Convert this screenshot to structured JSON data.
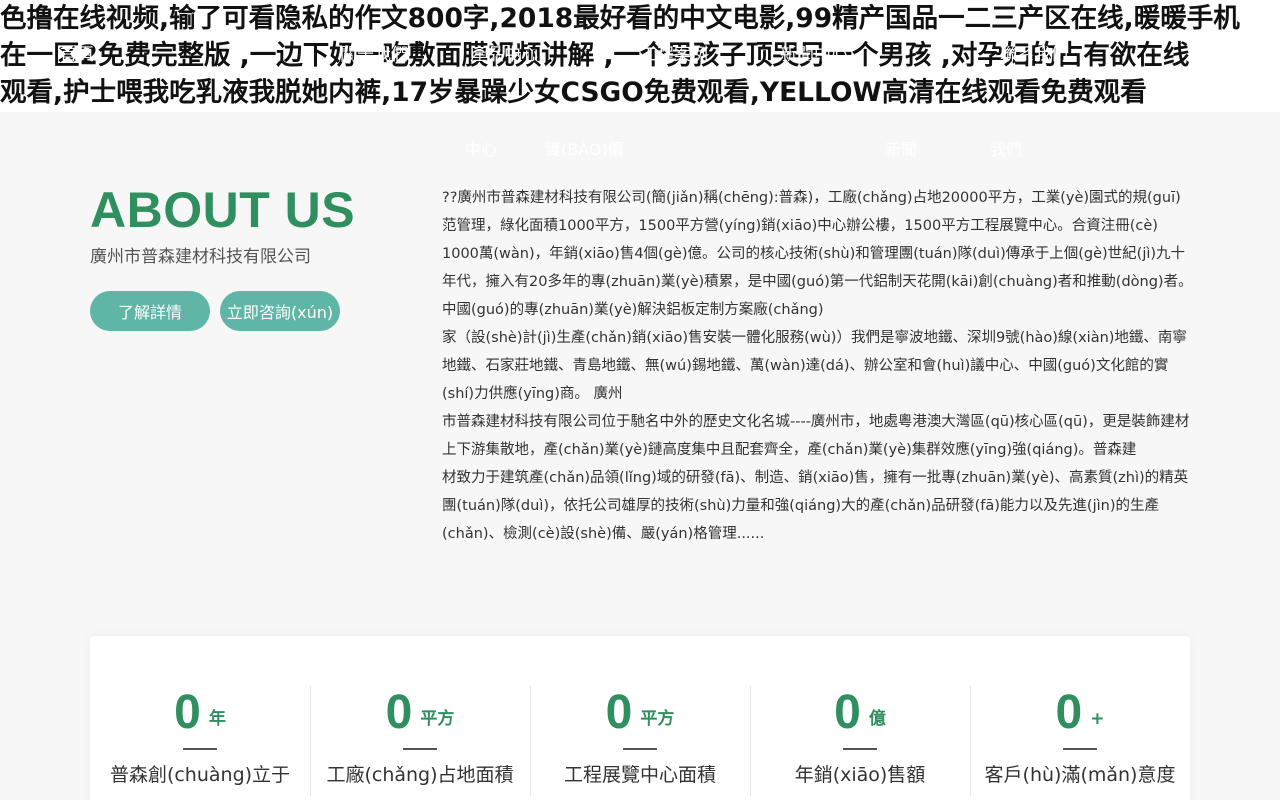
{
  "spam_heading": {
    "line1": "色撸在线视频,输了可看隐私的作文800字,2018最好看的中文电影,99精产国品一二三产区在线,暖暖手机",
    "line2": "在一区2免费完整版 ,一边下奶一吃敷面膜视频讲解 ,一个男孩子顶哭另一个男孩 ,对孕妇的占有欲在线",
    "line3": "观看,护士喂我吃乳液我脱她内裤,17岁暴躁少女CSGO免费观看,YELLOW高清在线观看免费观看"
  },
  "ghost_nav": {
    "item1": "首頁",
    "item2": "關于我們",
    "item3": "產品中心",
    "item4": "工程案例",
    "item5": "新聞中心",
    "item6": "聯系我們"
  },
  "subnav": {
    "item1": "中心",
    "item2": "資(BÀO)價",
    "item3": "新聞",
    "item4": "我們"
  },
  "about": {
    "title": "ABOUT US",
    "company": "廣州市普森建材科技有限公司",
    "btn_detail": "了解詳情",
    "btn_consult": "立即咨詢(xún)",
    "paragraphs": [
      "??廣州市普森建材科技有限公司(簡(jiǎn)稱(chēng):普森)，工廠(chǎng)占地20000平方，工業(yè)園式的規(guī)范管理，綠化面積1000平方，1500平方營(yíng)銷(xiāo)中心辦公樓，1500平方工程展覽中心。合資注冊(cè)",
      "1000萬(wàn)，年銷(xiāo)售4個(gè)億。公司的核心技術(shù)和管理團(tuán)隊(duì)傳承于上個(gè)世紀(jì)九十年代，擁入有20多年的專(zhuān)業(yè)積累，是中國(guó)第一代鋁制天花開(kāi)創(chuàng)者和推動(dòng)者。中國(guó)的專(zhuān)業(yè)解決鋁板定制方案廠(chǎng)",
      "家（設(shè)計(jì)生產(chǎn)銷(xiāo)售安裝一體化服務(wù)）我們是寧波地鐵、深圳9號(hào)線(xiàn)地鐵、南寧地鐵、石家莊地鐵、青島地鐵、無(wú)錫地鐵、萬(wàn)達(dá)、辦公室和會(huì)議中心、中國(guó)文化館的實(shí)力供應(yīng)商。 廣州",
      "市普森建材科技有限公司位于馳名中外的歷史文化名城----廣州市，地處粵港澳大灣區(qū)核心區(qū)，更是裝飾建材上下游集散地，產(chǎn)業(yè)鏈高度集中且配套齊全，產(chǎn)業(yè)集群效應(yīng)強(qiáng)。普森建",
      "材致力于建筑產(chǎn)品領(lǐng)域的研發(fā)、制造、銷(xiāo)售，擁有一批專(zhuān)業(yè)、高素質(zhì)的精英團(tuán)隊(duì)，依托公司雄厚的技術(shù)力量和強(qiáng)大的產(chǎn)品研發(fā)能力以及先進(jìn)的生產(chǎn)、檢測(cè)設(shè)備、嚴(yán)格管理......"
    ]
  },
  "stats": [
    {
      "value": "0",
      "unit": "年",
      "label": "普森創(chuàng)立于"
    },
    {
      "value": "0",
      "unit": "平方",
      "label": "工廠(chǎng)占地面積"
    },
    {
      "value": "0",
      "unit": "平方",
      "label": "工程展覽中心面積"
    },
    {
      "value": "0",
      "unit": "億",
      "label": "年銷(xiāo)售額"
    },
    {
      "value": "0",
      "unit": "+",
      "label": "客戶(hù)滿(mǎn)意度"
    }
  ],
  "colors": {
    "brand_green": "#2f8f5f",
    "button_teal": "#5fb5a6"
  }
}
